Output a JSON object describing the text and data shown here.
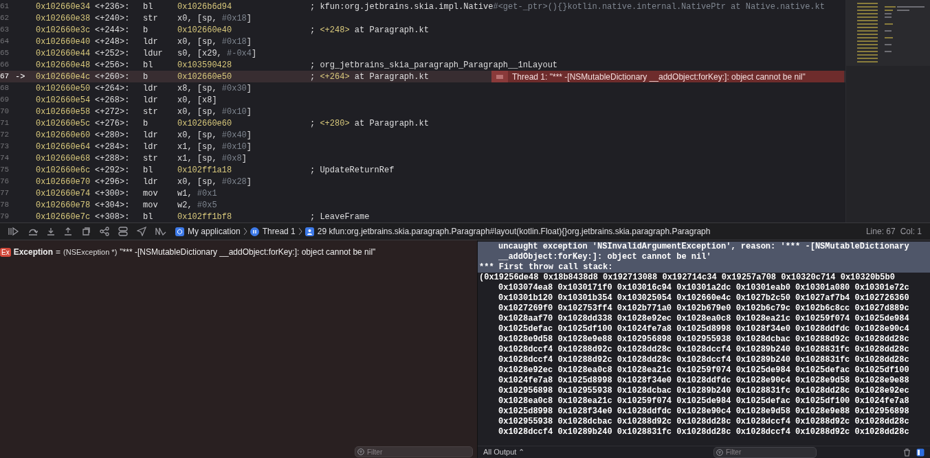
{
  "disassembly": {
    "rows": [
      {
        "line": "61",
        "current": false,
        "address": "0x102660e34",
        "offset": "<+236>:",
        "mnemonic": "bl",
        "operands": [
          {
            "text": "0x1026b6d94",
            "color": "#d9c97c"
          }
        ],
        "comment": [
          {
            "text": "; kfun:org.jetbrains.skia.impl.Native",
            "color": "#dfdfe0"
          },
          {
            "text": "#<get-_ptr>(){}kotlin.native.internal.NativePtr at Native.native.kt",
            "color": "#7f8690"
          }
        ]
      },
      {
        "line": "62",
        "current": false,
        "address": "0x102660e38",
        "offset": "<+240>:",
        "mnemonic": "str",
        "operands": [
          {
            "text": "x0, [sp, ",
            "color": "#dfdfe0"
          },
          {
            "text": "#0x18",
            "color": "#7f8690"
          },
          {
            "text": "]",
            "color": "#dfdfe0"
          }
        ]
      },
      {
        "line": "63",
        "current": false,
        "address": "0x102660e3c",
        "offset": "<+244>:",
        "mnemonic": "b",
        "operands": [
          {
            "text": "0x102660e40",
            "color": "#d9c97c"
          }
        ],
        "comment": [
          {
            "text": "; ",
            "color": "#dfdfe0"
          },
          {
            "text": "<+248>",
            "color": "#d9c97c"
          },
          {
            "text": " at Paragraph.kt",
            "color": "#dfdfe0"
          }
        ]
      },
      {
        "line": "64",
        "current": false,
        "address": "0x102660e40",
        "offset": "<+248>:",
        "mnemonic": "ldr",
        "operands": [
          {
            "text": "x0, [sp, ",
            "color": "#dfdfe0"
          },
          {
            "text": "#0x18",
            "color": "#7f8690"
          },
          {
            "text": "]",
            "color": "#dfdfe0"
          }
        ]
      },
      {
        "line": "65",
        "current": false,
        "address": "0x102660e44",
        "offset": "<+252>:",
        "mnemonic": "ldur",
        "operands": [
          {
            "text": "s0, [x29, ",
            "color": "#dfdfe0"
          },
          {
            "text": "#-0x4",
            "color": "#7f8690"
          },
          {
            "text": "]",
            "color": "#dfdfe0"
          }
        ]
      },
      {
        "line": "66",
        "current": false,
        "address": "0x102660e48",
        "offset": "<+256>:",
        "mnemonic": "bl",
        "operands": [
          {
            "text": "0x103590428",
            "color": "#d9c97c"
          }
        ],
        "comment": [
          {
            "text": "; org_jetbrains_skia_paragraph_Paragraph__1nLayout",
            "color": "#dfdfe0"
          }
        ]
      },
      {
        "line": "67",
        "current": true,
        "marker": "->",
        "address": "0x102660e4c",
        "offset": "<+260>:",
        "mnemonic": "b",
        "operands": [
          {
            "text": "0x102660e50",
            "color": "#d9c97c"
          }
        ],
        "comment": [
          {
            "text": "; ",
            "color": "#dfdfe0"
          },
          {
            "text": "<+264>",
            "color": "#d9c97c"
          },
          {
            "text": " at Paragraph.kt",
            "color": "#dfdfe0"
          }
        ],
        "issue": "Thread 1: \"*** -[NSMutableDictionary __addObject:forKey:]: object cannot be nil\""
      },
      {
        "line": "68",
        "current": false,
        "address": "0x102660e50",
        "offset": "<+264>:",
        "mnemonic": "ldr",
        "operands": [
          {
            "text": "x8, [sp, ",
            "color": "#dfdfe0"
          },
          {
            "text": "#0x30",
            "color": "#7f8690"
          },
          {
            "text": "]",
            "color": "#dfdfe0"
          }
        ]
      },
      {
        "line": "69",
        "current": false,
        "address": "0x102660e54",
        "offset": "<+268>:",
        "mnemonic": "ldr",
        "operands": [
          {
            "text": "x0, [x8]",
            "color": "#dfdfe0"
          }
        ]
      },
      {
        "line": "70",
        "current": false,
        "address": "0x102660e58",
        "offset": "<+272>:",
        "mnemonic": "str",
        "operands": [
          {
            "text": "x0, [sp, ",
            "color": "#dfdfe0"
          },
          {
            "text": "#0x10",
            "color": "#7f8690"
          },
          {
            "text": "]",
            "color": "#dfdfe0"
          }
        ]
      },
      {
        "line": "71",
        "current": false,
        "address": "0x102660e5c",
        "offset": "<+276>:",
        "mnemonic": "b",
        "operands": [
          {
            "text": "0x102660e60",
            "color": "#d9c97c"
          }
        ],
        "comment": [
          {
            "text": "; ",
            "color": "#dfdfe0"
          },
          {
            "text": "<+280>",
            "color": "#d9c97c"
          },
          {
            "text": " at Paragraph.kt",
            "color": "#dfdfe0"
          }
        ]
      },
      {
        "line": "72",
        "current": false,
        "address": "0x102660e60",
        "offset": "<+280>:",
        "mnemonic": "ldr",
        "operands": [
          {
            "text": "x0, [sp, ",
            "color": "#dfdfe0"
          },
          {
            "text": "#0x40",
            "color": "#7f8690"
          },
          {
            "text": "]",
            "color": "#dfdfe0"
          }
        ]
      },
      {
        "line": "73",
        "current": false,
        "address": "0x102660e64",
        "offset": "<+284>:",
        "mnemonic": "ldr",
        "operands": [
          {
            "text": "x1, [sp, ",
            "color": "#dfdfe0"
          },
          {
            "text": "#0x10",
            "color": "#7f8690"
          },
          {
            "text": "]",
            "color": "#dfdfe0"
          }
        ]
      },
      {
        "line": "74",
        "current": false,
        "address": "0x102660e68",
        "offset": "<+288>:",
        "mnemonic": "str",
        "operands": [
          {
            "text": "x1, [sp, ",
            "color": "#dfdfe0"
          },
          {
            "text": "#0x8",
            "color": "#7f8690"
          },
          {
            "text": "]",
            "color": "#dfdfe0"
          }
        ]
      },
      {
        "line": "75",
        "current": false,
        "address": "0x102660e6c",
        "offset": "<+292>:",
        "mnemonic": "bl",
        "operands": [
          {
            "text": "0x102ff1a18",
            "color": "#d9c97c"
          }
        ],
        "comment": [
          {
            "text": "; UpdateReturnRef",
            "color": "#dfdfe0"
          }
        ]
      },
      {
        "line": "76",
        "current": false,
        "address": "0x102660e70",
        "offset": "<+296>:",
        "mnemonic": "ldr",
        "operands": [
          {
            "text": "x0, [sp, ",
            "color": "#dfdfe0"
          },
          {
            "text": "#0x28",
            "color": "#7f8690"
          },
          {
            "text": "]",
            "color": "#dfdfe0"
          }
        ]
      },
      {
        "line": "77",
        "current": false,
        "address": "0x102660e74",
        "offset": "<+300>:",
        "mnemonic": "mov",
        "operands": [
          {
            "text": "w1, ",
            "color": "#dfdfe0"
          },
          {
            "text": "#0x1",
            "color": "#7f8690"
          }
        ]
      },
      {
        "line": "78",
        "current": false,
        "address": "0x102660e78",
        "offset": "<+304>:",
        "mnemonic": "mov",
        "operands": [
          {
            "text": "w2, ",
            "color": "#dfdfe0"
          },
          {
            "text": "#0x5",
            "color": "#7f8690"
          }
        ]
      },
      {
        "line": "79",
        "current": false,
        "address": "0x102660e7c",
        "offset": "<+308>:",
        "mnemonic": "bl",
        "operands": [
          {
            "text": "0x102ff1bf8",
            "color": "#d9c97c"
          }
        ],
        "comment": [
          {
            "text": "; LeaveFrame",
            "color": "#dfdfe0"
          }
        ]
      }
    ]
  },
  "breadcrumb": [
    {
      "kind": "app",
      "label": "My application"
    },
    {
      "kind": "thread",
      "label": "Thread 1"
    },
    {
      "kind": "frame",
      "label": "29 kfun:org.jetbrains.skia.paragraph.Paragraph#layout(kotlin.Float){}org.jetbrains.skia.paragraph.Paragraph"
    }
  ],
  "cursor": {
    "line": "Line: 67",
    "column": "Col: 1"
  },
  "variables": [
    {
      "badge": "Ex",
      "name": "Exception",
      "equals": "=",
      "type": "(NSException *)",
      "value": "\"*** -[NSMutableDictionary __addObject:forKey:]: object cannot be nil\""
    }
  ],
  "variables_filter": {
    "placeholder": "Filter"
  },
  "console": {
    "lines": [
      {
        "kind": "wrapped",
        "selected": true,
        "text": "uncaught exception 'NSInvalidArgumentException', reason: '*** -[NSMutableDictionary __addObject:forKey:]: object cannot be nil'"
      },
      {
        "kind": "plain",
        "selected": true,
        "text": "*** First throw call stack:"
      },
      {
        "kind": "plain",
        "selected": false,
        "text": "(0x19256de48 0x18b8438d8 0x192713088 0x192714c34 0x19257a708 0x10320c714 0x10320b5b0"
      },
      {
        "kind": "indented",
        "selected": false,
        "text": "0x103074ea8 0x1030171f0 0x103016c94 0x10301a2dc 0x10301eab0 0x10301a080 0x10301e72c"
      },
      {
        "kind": "indented",
        "selected": false,
        "text": "0x10301b120 0x10301b354 0x103025054 0x102660e4c 0x1027b2c50 0x1027af7b4 0x102726360"
      },
      {
        "kind": "indented",
        "selected": false,
        "text": "0x1027269f0 0x102753ff4 0x102b771a0 0x102b679e0 0x102b6c79c 0x102b6c8cc 0x1027d889c"
      },
      {
        "kind": "indented",
        "selected": false,
        "text": "0x1028aaf70 0x1028dd338 0x1028e92ec 0x1028ea0c8 0x1028ea21c 0x10259f074 0x1025de984"
      },
      {
        "kind": "indented",
        "selected": false,
        "text": "0x1025defac 0x1025df100 0x1024fe7a8 0x1025d8998 0x1028f34e0 0x1028ddfdc 0x1028e90c4"
      },
      {
        "kind": "indented",
        "selected": false,
        "text": "0x1028e9d58 0x1028e9e88 0x102956898 0x102955938 0x1028dcbac 0x10288d92c 0x1028dd28c"
      },
      {
        "kind": "indented",
        "selected": false,
        "text": "0x1028dccf4 0x10288d92c 0x1028dd28c 0x1028dccf4 0x10289b240 0x1028831fc 0x1028dd28c"
      },
      {
        "kind": "indented",
        "selected": false,
        "text": "0x1028dccf4 0x10288d92c 0x1028dd28c 0x1028dccf4 0x10289b240 0x1028831fc 0x1028dd28c"
      },
      {
        "kind": "indented",
        "selected": false,
        "text": "0x1028e92ec 0x1028ea0c8 0x1028ea21c 0x10259f074 0x1025de984 0x1025defac 0x1025df100"
      },
      {
        "kind": "indented",
        "selected": false,
        "text": "0x1024fe7a8 0x1025d8998 0x1028f34e0 0x1028ddfdc 0x1028e90c4 0x1028e9d58 0x1028e9e88"
      },
      {
        "kind": "indented",
        "selected": false,
        "text": "0x102956898 0x102955938 0x1028dcbac 0x10289b240 0x1028831fc 0x1028dd28c 0x1028e92ec"
      },
      {
        "kind": "indented",
        "selected": false,
        "text": "0x1028ea0c8 0x1028ea21c 0x10259f074 0x1025de984 0x1025defac 0x1025df100 0x1024fe7a8"
      },
      {
        "kind": "indented",
        "selected": false,
        "text": "0x1025d8998 0x1028f34e0 0x1028ddfdc 0x1028e90c4 0x1028e9d58 0x1028e9e88 0x102956898"
      },
      {
        "kind": "indented",
        "selected": false,
        "text": "0x102955938 0x1028dcbac 0x10288d92c 0x1028dd28c 0x1028dccf4 0x10288d92c 0x1028dd28c"
      },
      {
        "kind": "indented",
        "selected": false,
        "text": "0x1028dccf4 0x10289b240 0x1028831fc 0x1028dd28c 0x1028dccf4 0x10288d92c 0x1028dd28c"
      }
    ]
  },
  "console_output_menu": "All Output ⌃",
  "console_filter": {
    "placeholder": "Filter"
  }
}
